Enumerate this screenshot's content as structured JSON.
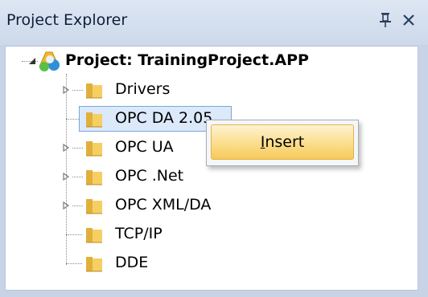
{
  "panel": {
    "title": "Project Explorer",
    "pin_icon": "pin-icon",
    "close_icon": "close-icon"
  },
  "tree": {
    "root": {
      "label": "Project: TrainingProject.APP",
      "icon": "project-icon",
      "expanded": true
    },
    "items": [
      {
        "label": "Drivers",
        "icon": "folder-icon",
        "expandable": true
      },
      {
        "label": "OPC DA 2.05",
        "icon": "folder-icon",
        "expandable": false,
        "selected": true
      },
      {
        "label": "OPC UA",
        "icon": "folder-icon",
        "expandable": true
      },
      {
        "label": "OPC .Net",
        "icon": "folder-icon",
        "expandable": true
      },
      {
        "label": "OPC XML/DA",
        "icon": "folder-icon",
        "expandable": true
      },
      {
        "label": "TCP/IP",
        "icon": "folder-icon",
        "expandable": false
      },
      {
        "label": "DDE",
        "icon": "folder-icon",
        "expandable": false
      }
    ]
  },
  "context_menu": {
    "items": [
      {
        "label": "Insert",
        "accelerator": "I"
      }
    ]
  },
  "colors": {
    "selection_bg": "#dbe9fa",
    "selection_border": "#7aa6dc",
    "menu_highlight": "#fbde8c",
    "panel_bg": "#c8d4e6"
  }
}
